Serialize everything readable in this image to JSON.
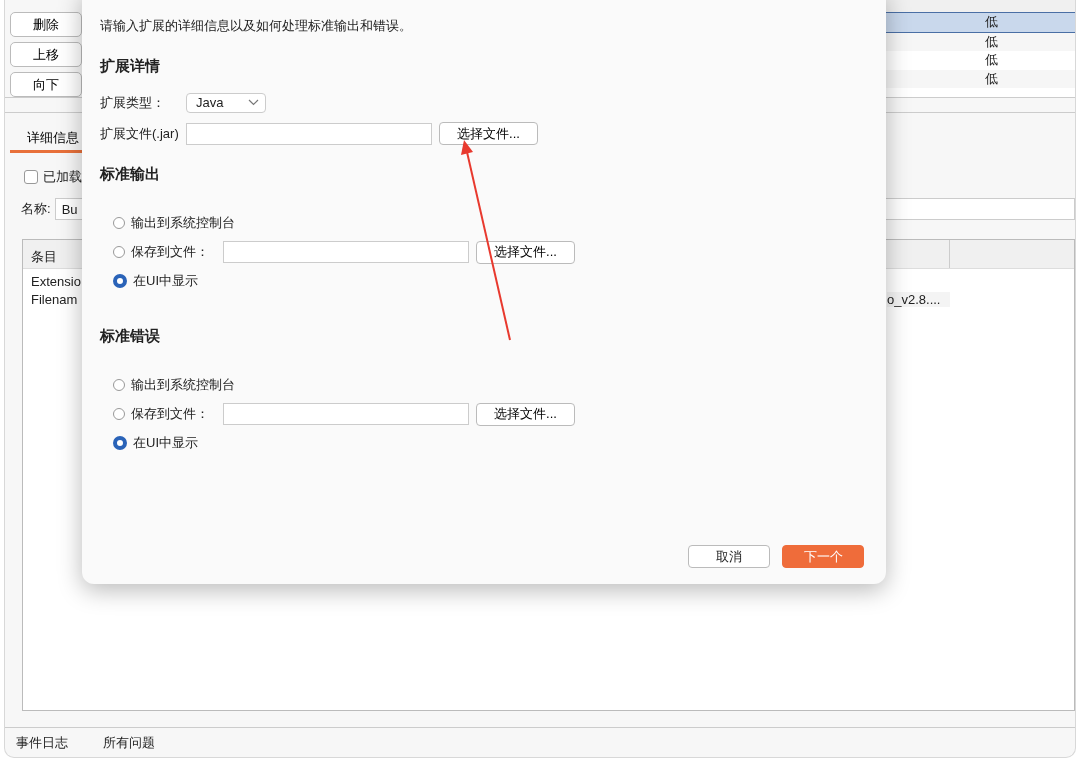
{
  "background": {
    "side_buttons": [
      "删除",
      "上移",
      "向下"
    ],
    "top_rows": [
      {
        "column_4": "低",
        "selected": true
      },
      {
        "column_4": "低",
        "selected": false
      },
      {
        "column_4": "低",
        "selected": false
      },
      {
        "column_4": "低",
        "selected": false
      }
    ],
    "tabs": [
      {
        "label": "详细信息",
        "selected": true
      }
    ],
    "loaded_checkbox": {
      "label": "已加载",
      "checked": false
    },
    "name_field": {
      "label": "名称:",
      "value": "Bu"
    },
    "detail_table": {
      "columns": [
        "条目"
      ],
      "rows": [
        {
          "column_1": "Extensio"
        },
        {
          "column_1": "Filenam",
          "column_2": "o_v2.8...."
        }
      ]
    },
    "status_bar": [
      "事件日志",
      "所有问题"
    ]
  },
  "dialog": {
    "intro": "请输入扩展的详细信息以及如何处理标准输出和错误。",
    "details": {
      "heading": "扩展详情",
      "type_label": "扩展类型：",
      "type_value": "Java",
      "file_label": "扩展文件(.jar)",
      "file_button": "选择文件..."
    },
    "sections": [
      {
        "heading": "标准输出",
        "options": [
          {
            "label": "输出到系统控制台",
            "selected": false,
            "kind": "plain"
          },
          {
            "label": "保存到文件：",
            "selected": false,
            "kind": "file",
            "button": "选择文件..."
          },
          {
            "label": "在UI中显示",
            "selected": true,
            "kind": "plain"
          }
        ]
      },
      {
        "heading": "标准错误",
        "options": [
          {
            "label": "输出到系统控制台",
            "selected": false,
            "kind": "plain"
          },
          {
            "label": "保存到文件：",
            "selected": false,
            "kind": "file",
            "button": "选择文件..."
          },
          {
            "label": "在UI中显示",
            "selected": true,
            "kind": "plain"
          }
        ]
      }
    ],
    "buttons": [
      {
        "label": "取消",
        "kind": "secondary"
      },
      {
        "label": "下一个",
        "kind": "primary"
      }
    ]
  }
}
